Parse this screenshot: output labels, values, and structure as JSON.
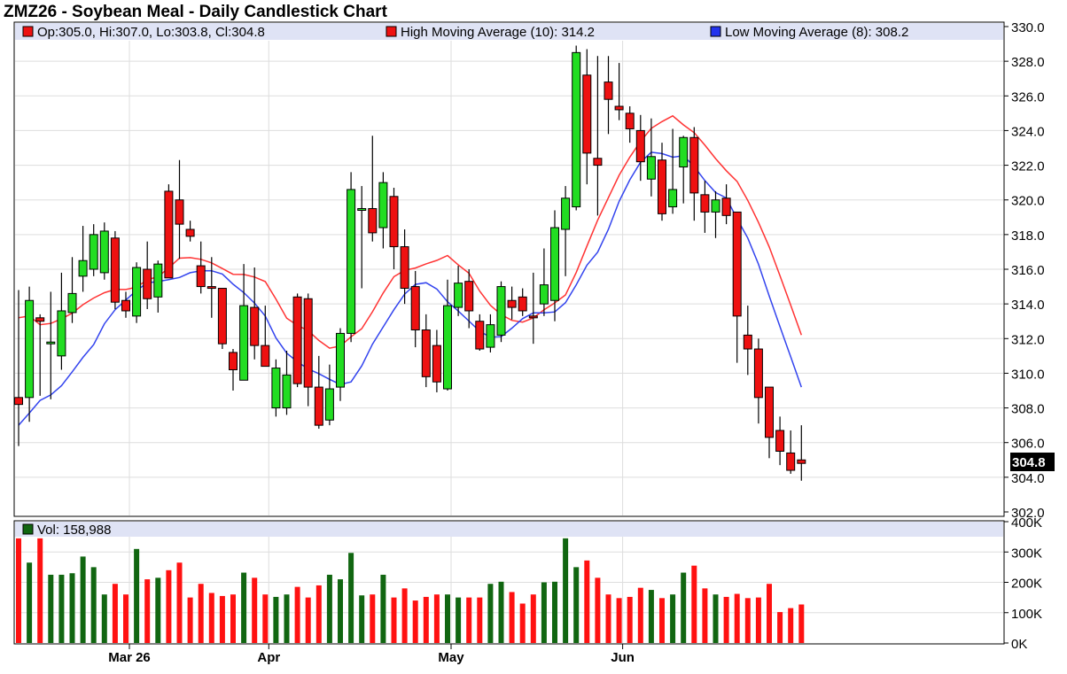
{
  "chart_data": {
    "type": "candlestick",
    "title": "ZMZ26 - Soybean Meal - Daily Candlestick Chart",
    "legend": {
      "ohlc": "Op:305.0, Hi:307.0, Lo:303.8, Cl:304.8",
      "high_ma": "High Moving Average (10): 314.2",
      "low_ma": "Low Moving Average (8): 308.2",
      "volume": "Vol: 158,988"
    },
    "price_axis": {
      "ylim": [
        302,
        330
      ],
      "ticks": [
        "302.0",
        "304.0",
        "306.0",
        "308.0",
        "310.0",
        "312.0",
        "314.0",
        "316.0",
        "318.0",
        "320.0",
        "322.0",
        "324.0",
        "326.0",
        "328.0",
        "330.0"
      ]
    },
    "volume_axis": {
      "ylim": [
        0,
        400000
      ],
      "ticks": [
        "0K",
        "100K",
        "200K",
        "300K",
        "400K"
      ]
    },
    "x_ticks": [
      {
        "label": "Mar 26",
        "index": 10
      },
      {
        "label": "Apr",
        "index": 23
      },
      {
        "label": "May",
        "index": 40
      },
      {
        "label": "Jun",
        "index": 56
      }
    ],
    "last_price": "304.8",
    "colors": {
      "up": "#22dd22",
      "down": "#ee1111",
      "high_ma": "#ff3333",
      "low_ma": "#3344ee",
      "vol_up": "#116611",
      "vol_down": "#ff1111",
      "vol_flat": "#000066",
      "last_box": "#000000"
    },
    "candles": [
      {
        "o": 308.6,
        "h": 314.8,
        "l": 305.8,
        "c": 308.2
      },
      {
        "o": 308.6,
        "h": 315.0,
        "l": 307.2,
        "c": 314.2
      },
      {
        "o": 313.2,
        "h": 313.4,
        "l": 308.7,
        "c": 313.0
      },
      {
        "o": 311.8,
        "h": 314.7,
        "l": 308.5,
        "c": 311.8
      },
      {
        "o": 311.0,
        "h": 315.8,
        "l": 310.2,
        "c": 313.6
      },
      {
        "o": 313.5,
        "h": 316.7,
        "l": 312.9,
        "c": 314.6
      },
      {
        "o": 315.6,
        "h": 318.5,
        "l": 314.7,
        "c": 316.5
      },
      {
        "o": 316.0,
        "h": 318.6,
        "l": 315.6,
        "c": 318.0
      },
      {
        "o": 315.8,
        "h": 318.7,
        "l": 315.4,
        "c": 318.2
      },
      {
        "o": 317.8,
        "h": 318.2,
        "l": 313.7,
        "c": 314.1
      },
      {
        "o": 314.2,
        "h": 314.7,
        "l": 313.2,
        "c": 313.6
      },
      {
        "o": 313.3,
        "h": 316.4,
        "l": 312.9,
        "c": 316.1
      },
      {
        "o": 316.0,
        "h": 317.6,
        "l": 313.7,
        "c": 314.3
      },
      {
        "o": 314.4,
        "h": 316.5,
        "l": 313.5,
        "c": 316.3
      },
      {
        "o": 320.5,
        "h": 320.9,
        "l": 315.6,
        "c": 315.5
      },
      {
        "o": 320.0,
        "h": 322.3,
        "l": 316.6,
        "c": 318.6
      },
      {
        "o": 318.3,
        "h": 318.8,
        "l": 317.6,
        "c": 317.9
      },
      {
        "o": 316.2,
        "h": 317.6,
        "l": 314.6,
        "c": 315.0
      },
      {
        "o": 315.0,
        "h": 316.7,
        "l": 313.2,
        "c": 314.9
      },
      {
        "o": 314.9,
        "h": 314.9,
        "l": 311.4,
        "c": 311.7
      },
      {
        "o": 311.2,
        "h": 311.4,
        "l": 309.0,
        "c": 310.2
      },
      {
        "o": 309.6,
        "h": 316.3,
        "l": 309.6,
        "c": 313.9
      },
      {
        "o": 313.8,
        "h": 316.1,
        "l": 310.8,
        "c": 311.6
      }
    ]
  }
}
